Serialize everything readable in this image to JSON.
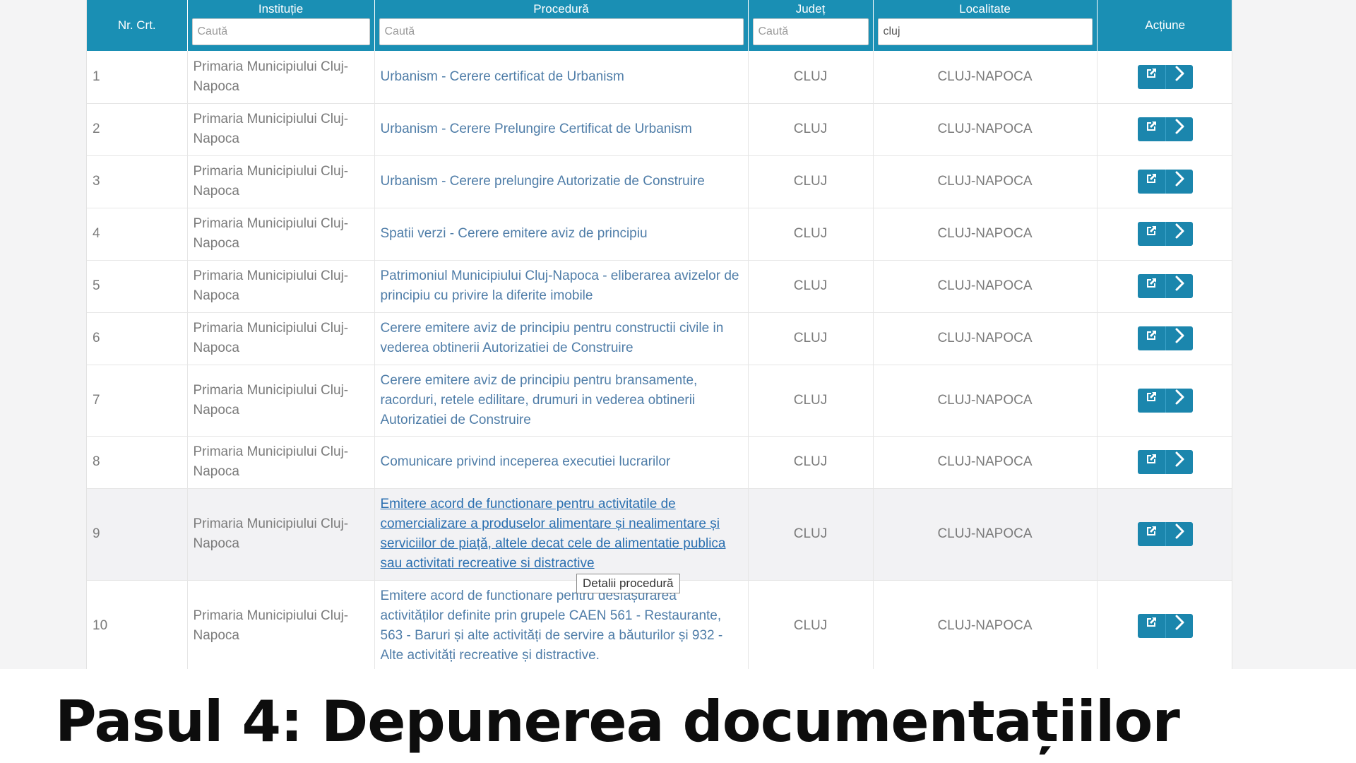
{
  "table": {
    "headers": {
      "nr": "Nr. Crt.",
      "institutie": "Instituție",
      "procedura": "Procedură",
      "judet": "Județ",
      "localitate": "Localitate",
      "actiune": "Acțiune"
    },
    "filters": {
      "institutie": {
        "value": "",
        "placeholder": "Caută"
      },
      "procedura": {
        "value": "",
        "placeholder": "Caută"
      },
      "judet": {
        "value": "",
        "placeholder": "Caută"
      },
      "localitate": {
        "value": "cluj",
        "placeholder": "Caută"
      }
    },
    "rows": [
      {
        "nr": "1",
        "institutie": "Primaria Municipiului Cluj-Napoca",
        "procedura": "Urbanism - Cerere certificat de Urbanism",
        "judet": "CLUJ",
        "localitate": "CLUJ-NAPOCA"
      },
      {
        "nr": "2",
        "institutie": "Primaria Municipiului Cluj-Napoca",
        "procedura": "Urbanism - Cerere Prelungire Certificat de Urbanism",
        "judet": "CLUJ",
        "localitate": "CLUJ-NAPOCA"
      },
      {
        "nr": "3",
        "institutie": "Primaria Municipiului Cluj-Napoca",
        "procedura": "Urbanism - Cerere prelungire Autorizatie de Construire",
        "judet": "CLUJ",
        "localitate": "CLUJ-NAPOCA"
      },
      {
        "nr": "4",
        "institutie": "Primaria Municipiului Cluj-Napoca",
        "procedura": "Spatii verzi - Cerere emitere aviz de principiu",
        "judet": "CLUJ",
        "localitate": "CLUJ-NAPOCA"
      },
      {
        "nr": "5",
        "institutie": "Primaria Municipiului Cluj-Napoca",
        "procedura": "Patrimoniul Municipiului Cluj-Napoca - eliberarea avizelor de principiu cu privire la diferite imobile",
        "judet": "CLUJ",
        "localitate": "CLUJ-NAPOCA"
      },
      {
        "nr": "6",
        "institutie": "Primaria Municipiului Cluj-Napoca",
        "procedura": "Cerere emitere aviz de principiu pentru constructii civile in vederea obtinerii Autorizatiei de Construire",
        "judet": "CLUJ",
        "localitate": "CLUJ-NAPOCA"
      },
      {
        "nr": "7",
        "institutie": "Primaria Municipiului Cluj-Napoca",
        "procedura": "Cerere emitere aviz de principiu pentru bransamente, racorduri, retele edilitare, drumuri in vederea obtinerii Autorizatiei de Construire",
        "judet": "CLUJ",
        "localitate": "CLUJ-NAPOCA"
      },
      {
        "nr": "8",
        "institutie": "Primaria Municipiului Cluj-Napoca",
        "procedura": "Comunicare privind inceperea executiei lucrarilor",
        "judet": "CLUJ",
        "localitate": "CLUJ-NAPOCA"
      },
      {
        "nr": "9",
        "institutie": "Primaria Municipiului Cluj-Napoca",
        "procedura": "Emitere acord de functionare pentru activitatile de comercializare a produselor alimentare și nealimentare și serviciilor de piață, altele decat cele de alimentatie publica sau activitati recreative si distractive",
        "judet": "CLUJ",
        "localitate": "CLUJ-NAPOCA"
      },
      {
        "nr": "10",
        "institutie": "Primaria Municipiului Cluj-Napoca",
        "procedura": "Emitere acord de functionare pentru desfășurarea activităților definite prin grupele CAEN 561 - Restaurante, 563 - Baruri și alte activități de servire a băuturilor și 932 - Alte activități recreative și distractive.",
        "judet": "CLUJ",
        "localitate": "CLUJ-NAPOCA"
      }
    ]
  },
  "tooltip": "Detalii procedură",
  "caption": "Pasul 4: Depunerea documentațiilor",
  "icons": {
    "open": "external-link-icon",
    "details": "chevron-right-icon"
  },
  "colors": {
    "header_bg": "#1a8fb4",
    "button_bg": "#1b86ad",
    "link": "#4f7da8"
  }
}
